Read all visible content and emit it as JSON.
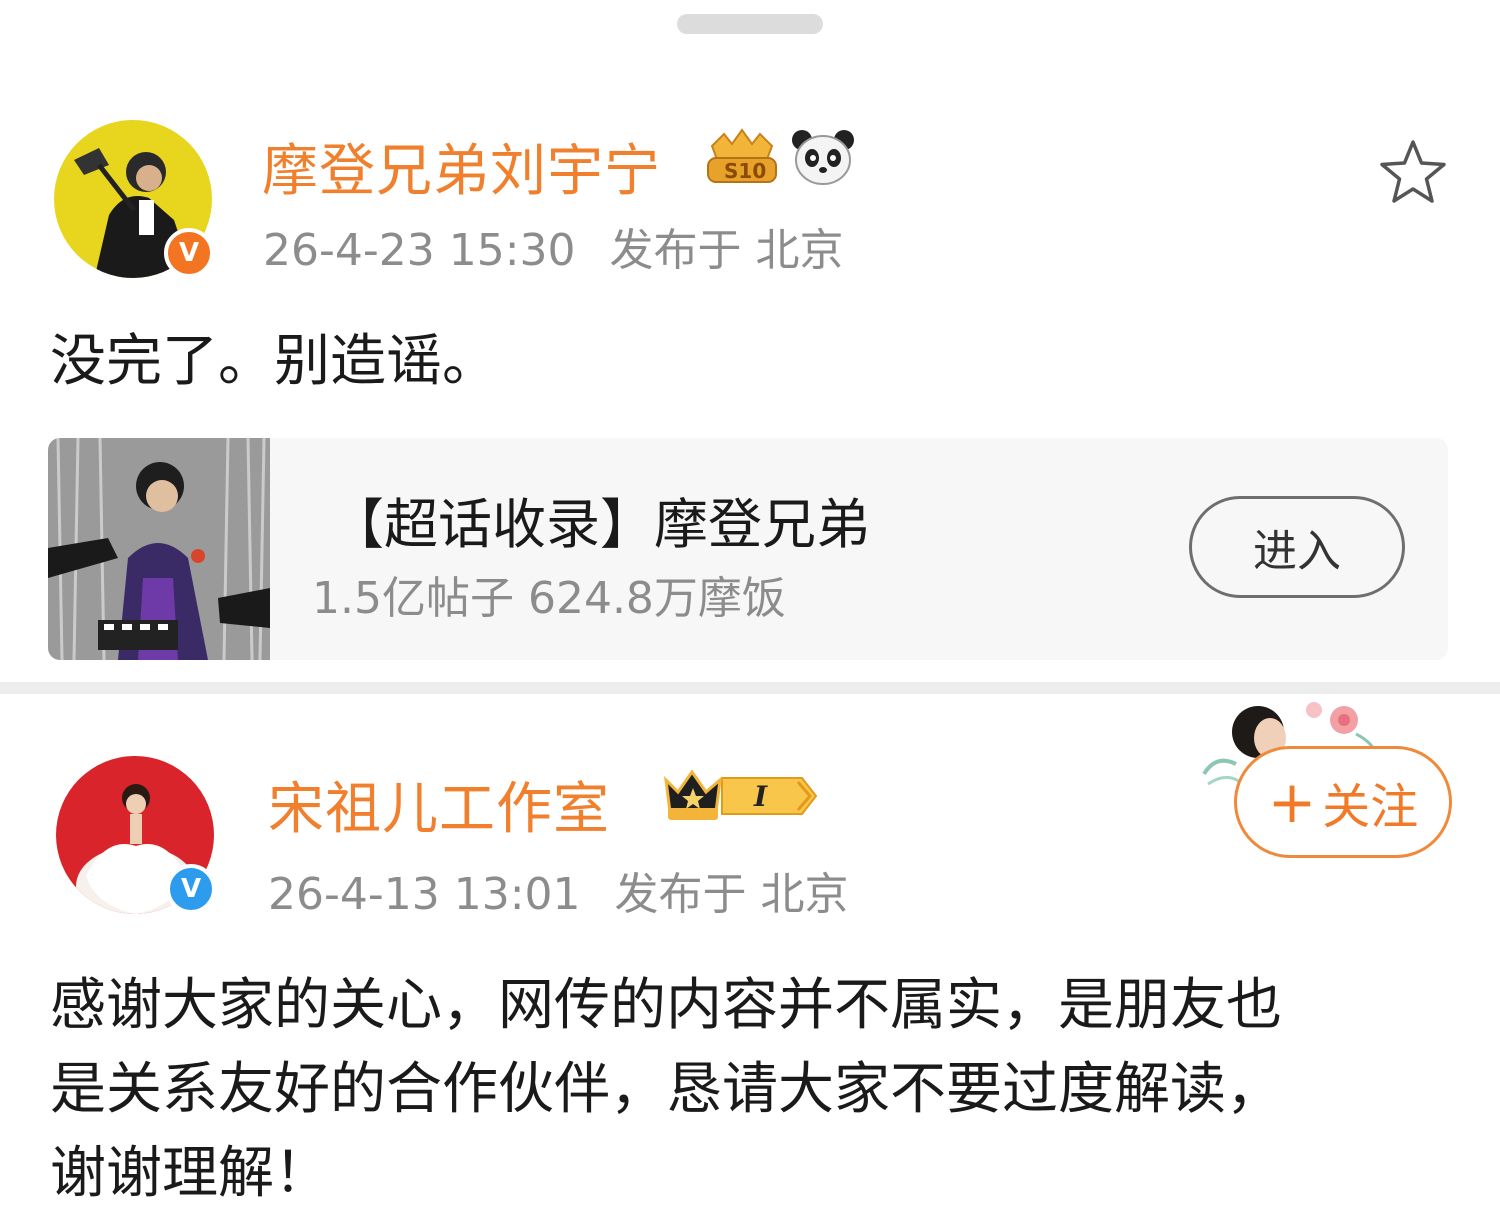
{
  "posts": [
    {
      "username": "摩登兄弟刘宇宁",
      "timestamp": "26-4-23 15:30",
      "location": "发布于 北京",
      "text": "没完了。别造谣。",
      "verify_badge": "V",
      "verify_color": "#f37421",
      "topic": {
        "title": "【超话收录】摩登兄弟",
        "stats": "1.5亿帖子 624.8万摩饭",
        "button": "进入"
      }
    },
    {
      "username": "宋祖儿工作室",
      "timestamp": "26-4-13 13:01",
      "location": "发布于 北京",
      "text_lines": [
        "感谢大家的关心，网传的内容并不属实，是朋友也",
        "是关系友好的合作伙伴，恳请大家不要过度解读，",
        "谢谢理解！"
      ],
      "verify_badge": "V",
      "verify_color": "#2d9cef",
      "follow_button": "关注",
      "level_badge": "I"
    }
  ],
  "icons": [
    "star-icon",
    "vip-crown-icon",
    "panda-icon",
    "level-badge-icon",
    "plus-icon"
  ],
  "colors": {
    "username": "#f0802e",
    "meta": "#8c8c8c",
    "accent": "#f08a3a"
  }
}
